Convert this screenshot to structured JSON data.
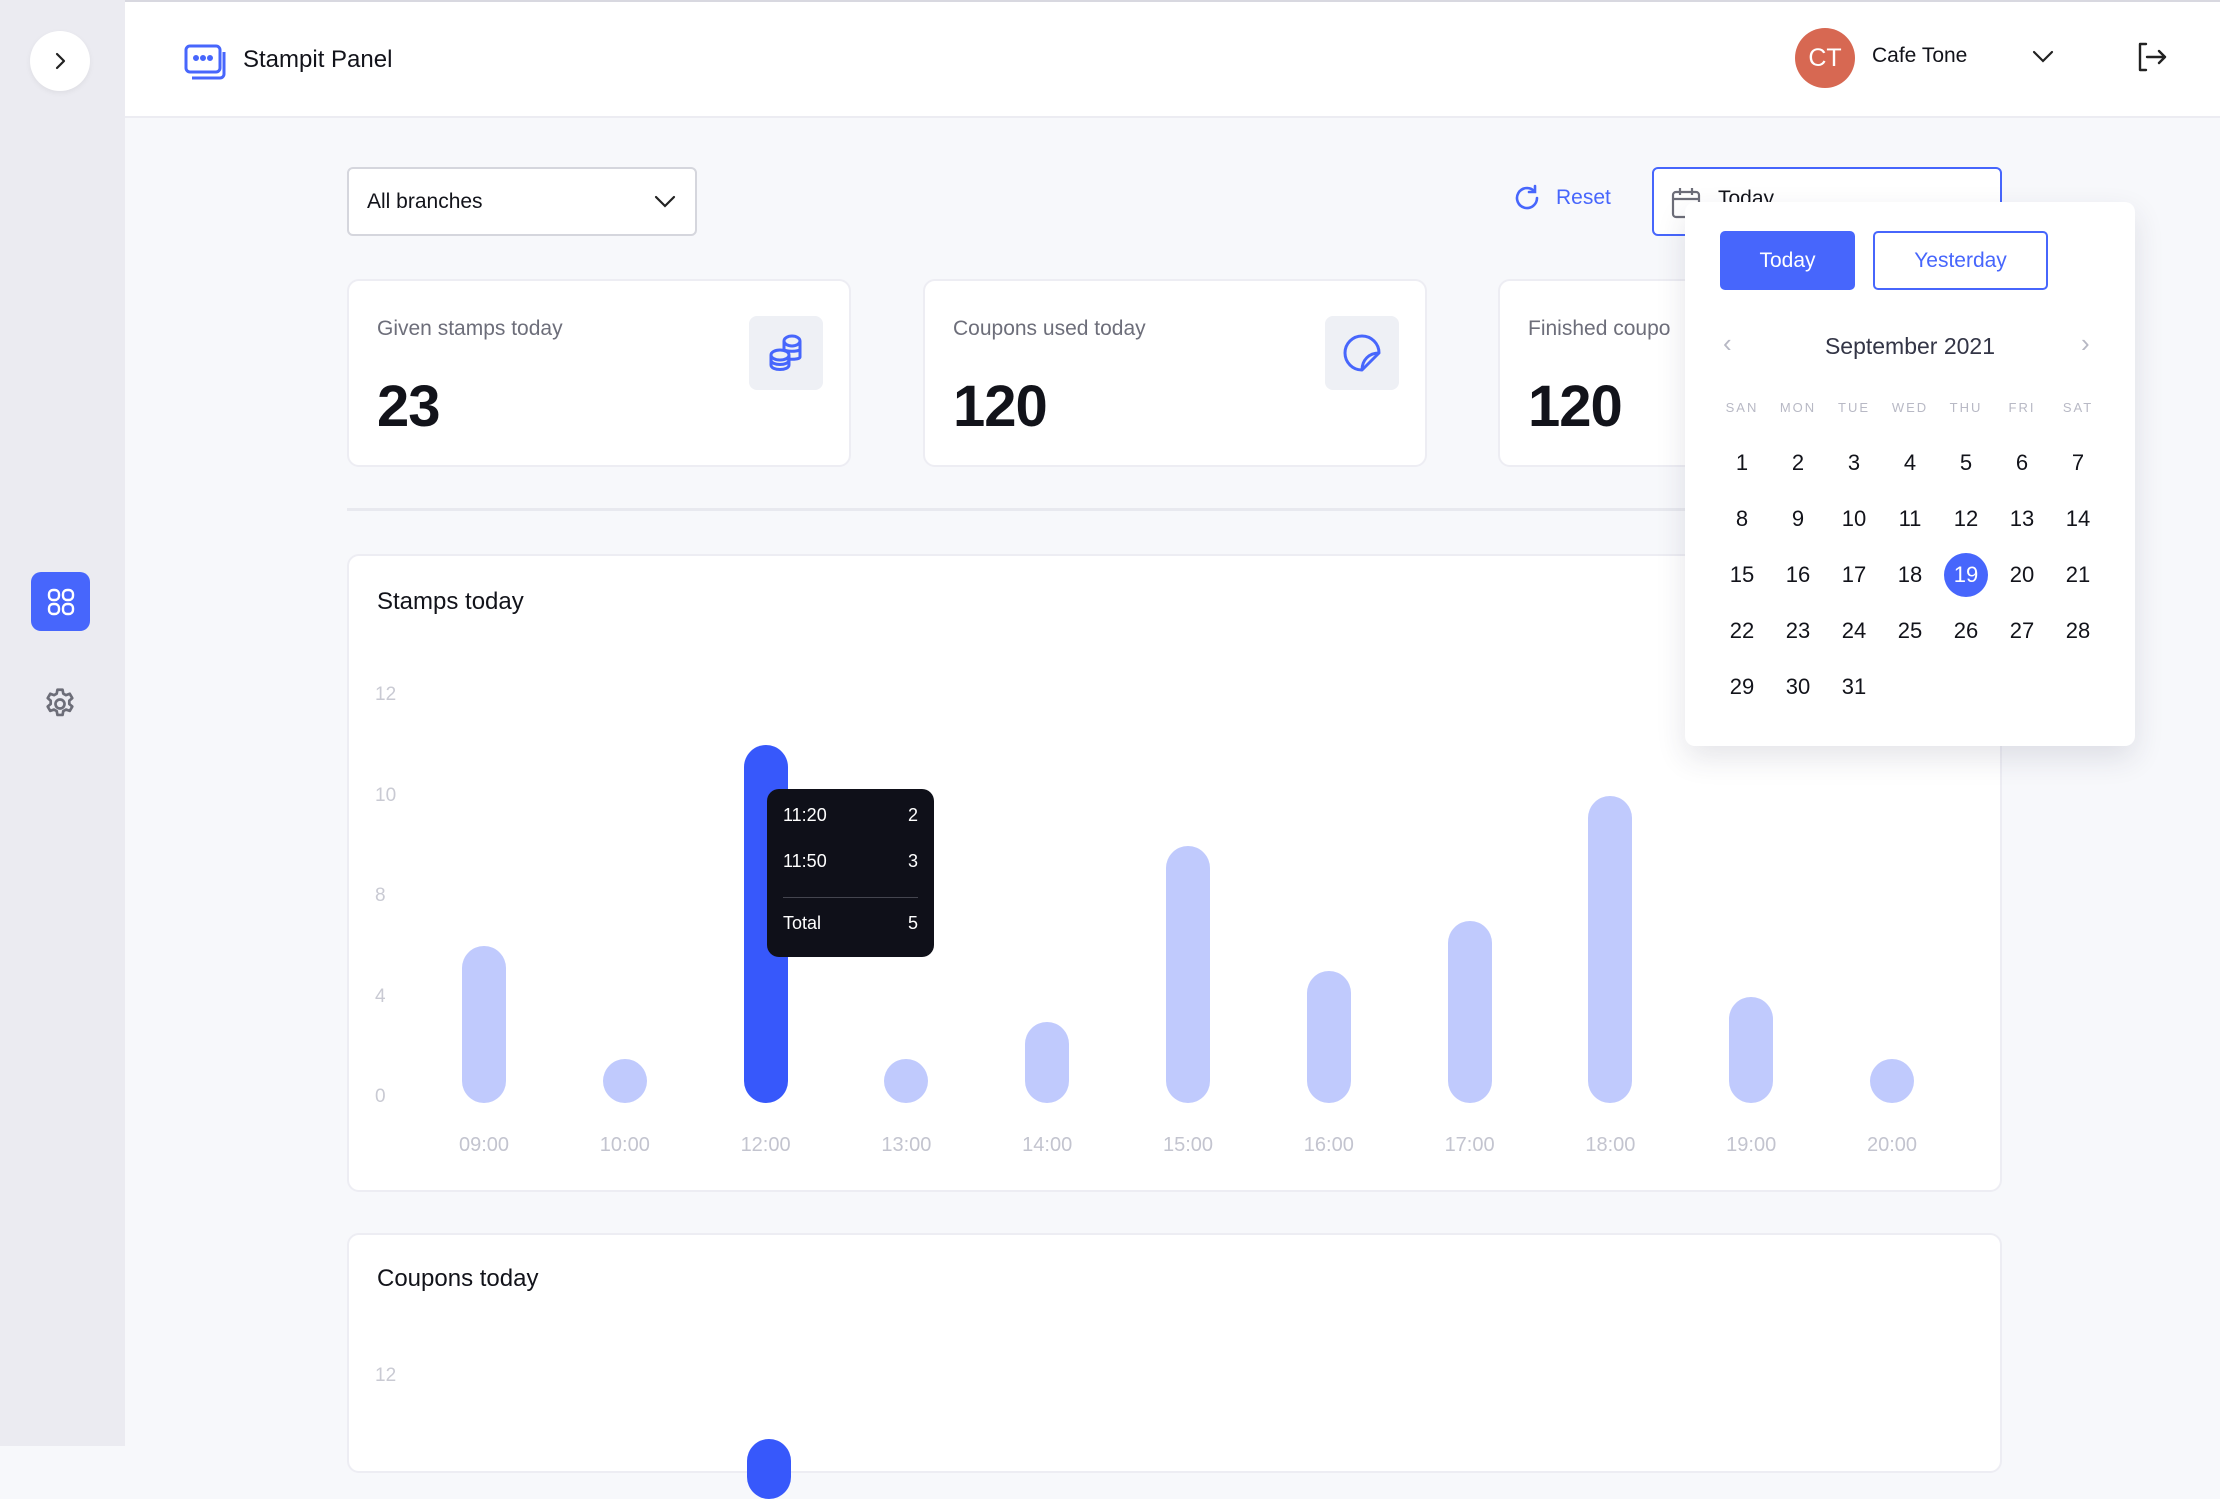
{
  "header": {
    "app_title": "Stampit Panel",
    "user": {
      "initials": "CT",
      "name": "Cafe Tone",
      "avatar_color": "#d76852"
    }
  },
  "sidebar": {
    "items": [
      {
        "name": "dashboard",
        "icon": "grid-icon",
        "active": true
      },
      {
        "name": "settings",
        "icon": "gear-icon",
        "active": false
      }
    ]
  },
  "filters": {
    "branch": "All branches",
    "reset_label": "Reset",
    "date_value": "Today"
  },
  "stats": [
    {
      "label": "Given stamps today",
      "value": "23",
      "icon": "coins-icon"
    },
    {
      "label": "Coupons used today",
      "value": "120",
      "icon": "sticker-icon"
    },
    {
      "label": "Finished coupo",
      "value": "120"
    }
  ],
  "date_picker": {
    "quick": [
      "Today",
      "Yesterday"
    ],
    "month_label": "September 2021",
    "weekdays": [
      "SAN",
      "MON",
      "TUE",
      "WED",
      "THU",
      "FRI",
      "SAT"
    ],
    "days": [
      1,
      2,
      3,
      4,
      5,
      6,
      7,
      8,
      9,
      10,
      11,
      12,
      13,
      14,
      15,
      16,
      17,
      18,
      19,
      20,
      21,
      22,
      23,
      24,
      25,
      26,
      27,
      28,
      29,
      30,
      31
    ],
    "selected_day": 19,
    "first_weekday_index": 0,
    "accent": "#4766fc"
  },
  "chart_data": [
    {
      "type": "bar",
      "title": "Stamps today",
      "categories": [
        "09:00",
        "10:00",
        "12:00",
        "13:00",
        "14:00",
        "15:00",
        "16:00",
        "17:00",
        "18:00",
        "19:00",
        "20:00"
      ],
      "values": [
        6,
        1,
        11,
        1,
        3,
        9,
        5,
        7,
        10,
        4,
        1
      ],
      "yticks": [
        "0",
        "4",
        "8",
        "10",
        "12"
      ],
      "highlighted": "12:00",
      "colors": {
        "bar": "#c0cafd",
        "highlight": "#3758fb"
      },
      "grid": false,
      "tooltip": {
        "rows": [
          {
            "label": "11:20",
            "value": "2"
          },
          {
            "label": "11:50",
            "value": "3"
          }
        ],
        "total_label": "Total",
        "total_value": "5"
      }
    },
    {
      "type": "bar",
      "title": "Coupons today",
      "yticks": [
        "12"
      ]
    }
  ]
}
